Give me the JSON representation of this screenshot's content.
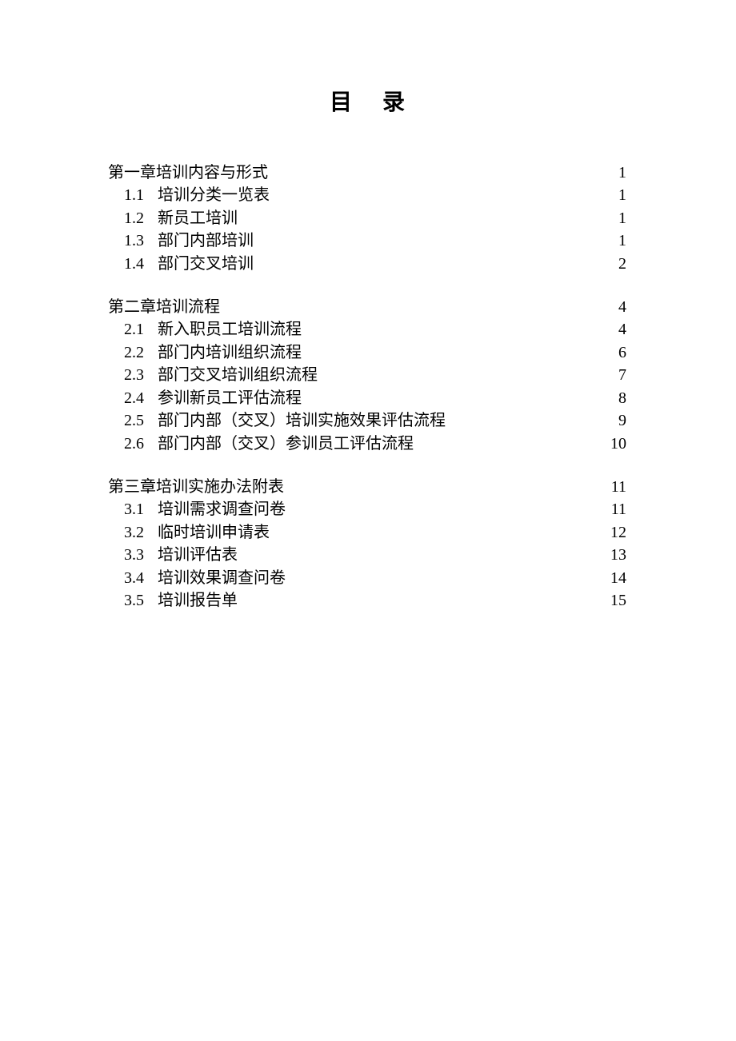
{
  "title": "目录",
  "chapters": [
    {
      "num": "第一章",
      "title": "培训内容与形式",
      "page": "1",
      "sections": [
        {
          "num": "1.1",
          "title": "培训分类一览表",
          "page": "1"
        },
        {
          "num": "1.2",
          "title": "新员工培训",
          "page": "1"
        },
        {
          "num": "1.3",
          "title": "部门内部培训",
          "page": "1"
        },
        {
          "num": "1.4",
          "title": "部门交叉培训",
          "page": "2"
        }
      ]
    },
    {
      "num": "第二章",
      "title": "培训流程",
      "page": "4",
      "sections": [
        {
          "num": "2.1",
          "title": "新入职员工培训流程",
          "page": "4"
        },
        {
          "num": "2.2",
          "title": "部门内培训组织流程",
          "page": "6"
        },
        {
          "num": "2.3",
          "title": "部门交叉培训组织流程",
          "page": "7"
        },
        {
          "num": "2.4",
          "title": "参训新员工评估流程",
          "page": "8"
        },
        {
          "num": "2.5",
          "title": "部门内部（交叉）培训实施效果评估流程",
          "page": "9"
        },
        {
          "num": "2.6",
          "title": "部门内部（交叉）参训员工评估流程",
          "page": "10"
        }
      ]
    },
    {
      "num": "第三章",
      "title": "培训实施办法附表",
      "page": "11",
      "sections": [
        {
          "num": "3.1",
          "title": "培训需求调查问卷",
          "page": "11"
        },
        {
          "num": "3.2",
          "title": "临时培训申请表",
          "page": "12"
        },
        {
          "num": "3.3",
          "title": "培训评估表",
          "page": "13"
        },
        {
          "num": "3.4",
          "title": "培训效果调查问卷",
          "page": "14"
        },
        {
          "num": "3.5",
          "title": "培训报告单",
          "page": "15"
        }
      ]
    }
  ]
}
